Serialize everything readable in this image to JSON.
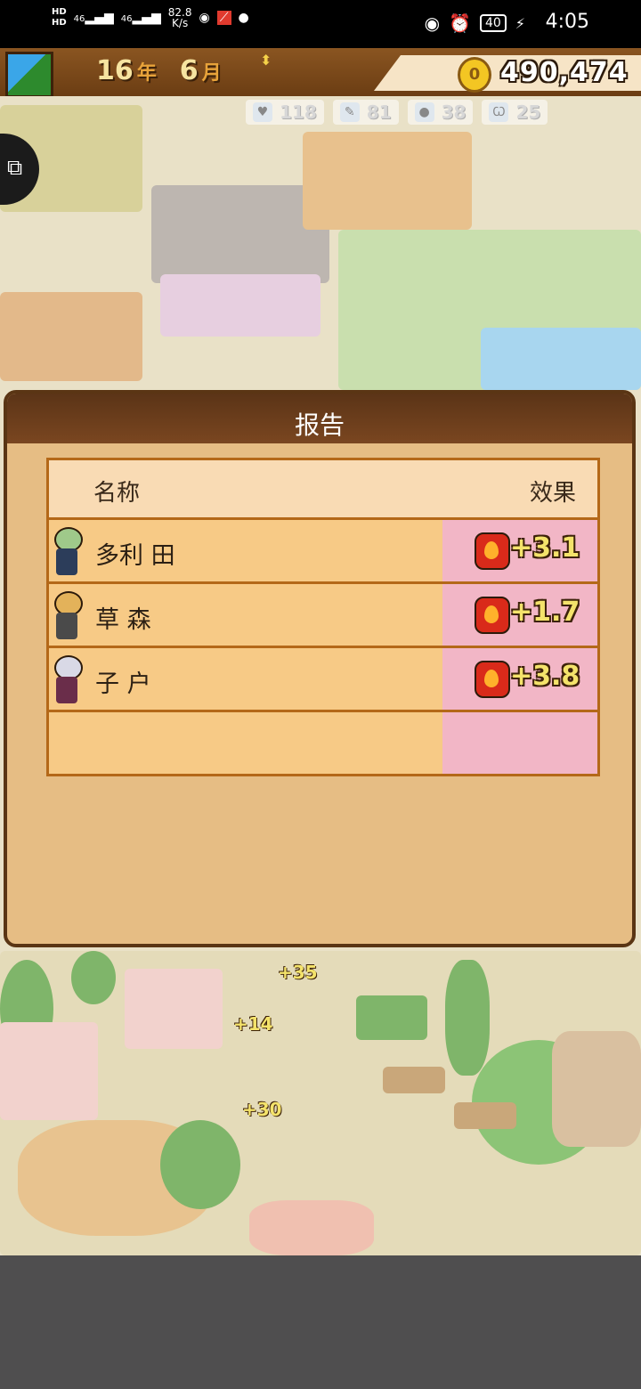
{
  "status_bar": {
    "hd1": "HD",
    "hd2": "HD",
    "signal1": "46",
    "signal2": "46",
    "net_speed": "82.8",
    "net_unit": "K/s",
    "battery": "40",
    "time": "4:05"
  },
  "game_header": {
    "year": "16",
    "year_unit": "年",
    "month": "6",
    "month_unit": "月",
    "money": "490,474",
    "coin_icon": "coin-icon",
    "stats": [
      {
        "icon": "heart-icon",
        "value": "118"
      },
      {
        "icon": "pencil-icon",
        "value": "81"
      },
      {
        "icon": "apple-icon",
        "value": "38"
      },
      {
        "icon": "cow-icon",
        "value": "25"
      }
    ]
  },
  "scene": {
    "floating_numbers": [
      "+35",
      "+14",
      "+30"
    ]
  },
  "report": {
    "title": "报告",
    "columns": {
      "name": "名称",
      "effect": "效果"
    },
    "rows": [
      {
        "name": "多利 田",
        "effect": "+3.1",
        "icon": "fire-icon",
        "avatar_hair": "#9fc98a",
        "avatar_body": "#2c3d5a"
      },
      {
        "name": "草 森",
        "effect": "+1.7",
        "icon": "fire-icon",
        "avatar_hair": "#e3b25a",
        "avatar_body": "#4a4a4a"
      },
      {
        "name": "子 户",
        "effect": "+3.8",
        "icon": "fire-icon",
        "avatar_hair": "#d9d9e6",
        "avatar_body": "#6a2d4a"
      },
      {
        "name": "",
        "effect": "",
        "icon": "",
        "avatar_hair": "",
        "avatar_body": ""
      }
    ]
  },
  "colors": {
    "panel_bg": "#e6bd84",
    "panel_header": "#5b3417",
    "row_bg": "#f7ca86",
    "effect_bg": "#f2b6c6",
    "bottom_bar": "#4f4e4f"
  }
}
